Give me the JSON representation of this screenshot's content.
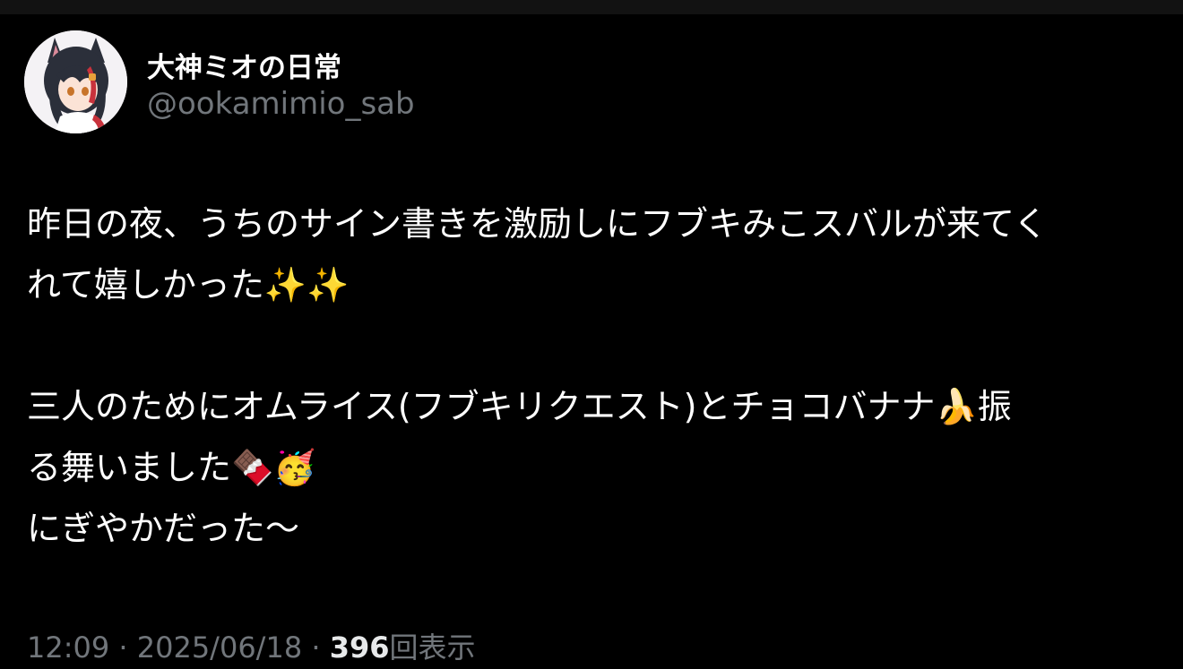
{
  "author": {
    "display_name": "大神ミオの日常",
    "handle": "@ookamimio_sab",
    "avatar_icon": "avatar-wolf-girl"
  },
  "tweet": {
    "line1": "昨日の夜、うちのサイン書きを激励しにフブキみこスバルが来てく",
    "line2": "れて嬉しかった✨✨",
    "line3": "三人のためにオムライス(フブキリクエスト)とチョコバナナ🍌振",
    "line4": "る舞いました🍫🥳",
    "line5": "にぎやかだった〜"
  },
  "meta": {
    "time": "12:09",
    "separator1": " · ",
    "date": "2025/06/18",
    "separator2": " · ",
    "views_count": "396",
    "views_label": "回表示"
  },
  "colors": {
    "background": "#000000",
    "text_primary": "#ffffff",
    "text_secondary": "#71767b"
  }
}
